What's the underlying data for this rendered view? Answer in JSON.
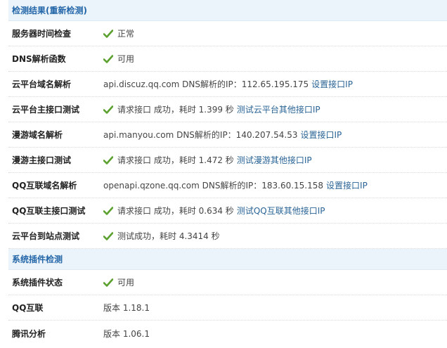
{
  "section1": {
    "header": "检测结果(重新检测)",
    "rows": [
      {
        "label": "服务器时间检查",
        "icon": "check",
        "text": "正常"
      },
      {
        "label": "DNS解析函数",
        "icon": "check",
        "text": "可用"
      },
      {
        "label": "云平台域名解析",
        "text": "api.discuz.qq.com DNS解析的IP：112.65.195.175",
        "link": "设置接口IP"
      },
      {
        "label": "云平台主接口测试",
        "icon": "check",
        "text": "请求接口 成功，耗时 1.399 秒",
        "link": "测试云平台其他接口IP"
      },
      {
        "label": "漫游域名解析",
        "text": "api.manyou.com DNS解析的IP：140.207.54.53",
        "link": "设置接口IP"
      },
      {
        "label": "漫游主接口测试",
        "icon": "check",
        "text": "请求接口 成功，耗时 1.472 秒",
        "link": "测试漫游其他接口IP"
      },
      {
        "label": "QQ互联域名解析",
        "text": "openapi.qzone.qq.com DNS解析的IP：183.60.15.158",
        "link": "设置接口IP"
      },
      {
        "label": "QQ互联主接口测试",
        "icon": "check",
        "text": "请求接口 成功，耗时 0.634 秒",
        "link": "测试QQ互联其他接口IP"
      },
      {
        "label": "云平台到站点测试",
        "icon": "check",
        "text": "测试成功，耗时 4.3414 秒"
      }
    ]
  },
  "section2": {
    "header": "系统插件检测",
    "rows": [
      {
        "label": "系统插件状态",
        "icon": "check",
        "text": "可用"
      },
      {
        "label": "QQ互联",
        "text": "版本 1.18.1"
      },
      {
        "label": "腾讯分析",
        "text": "版本 1.06.1"
      }
    ]
  },
  "colors": {
    "header_bg": "#ecf4fb",
    "header_text": "#2366a8",
    "link": "#2a6496",
    "check": "#5aa02c"
  }
}
